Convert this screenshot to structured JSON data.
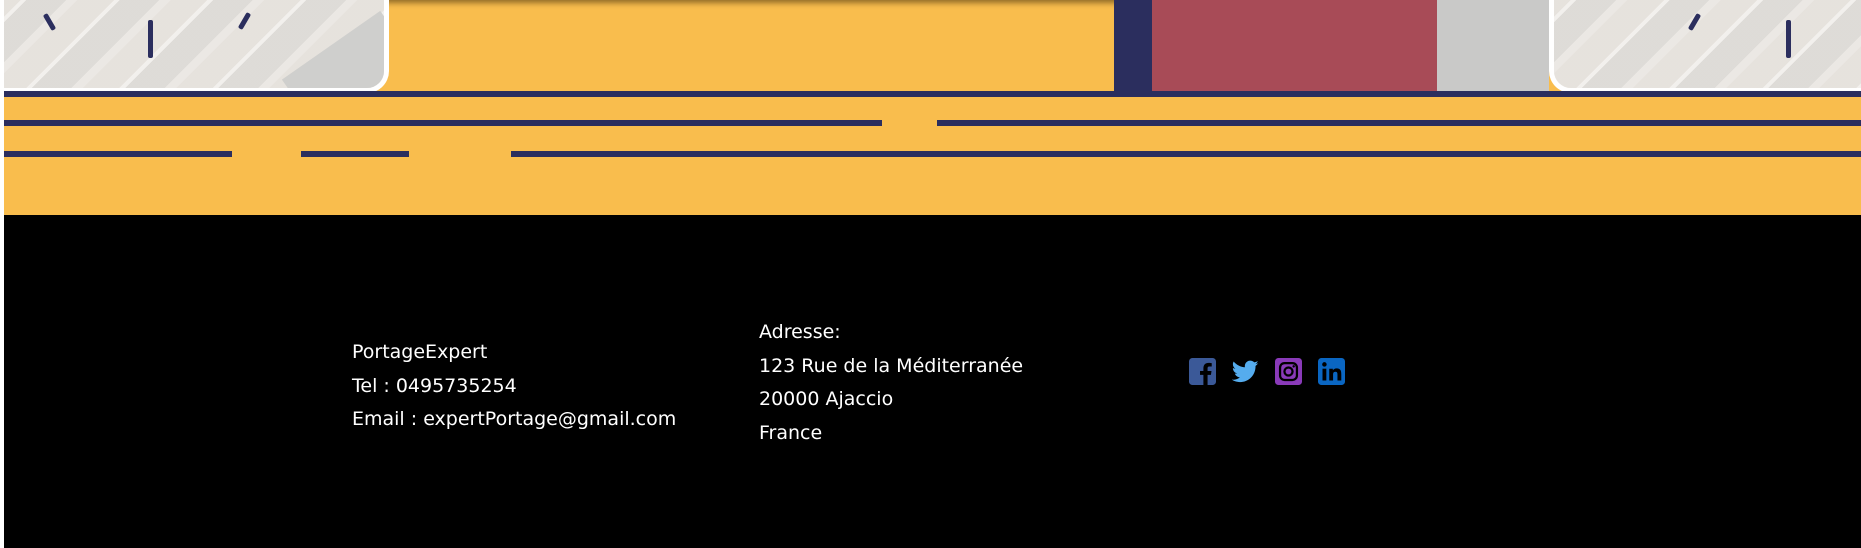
{
  "footer": {
    "contact": {
      "company": "PortageExpert",
      "tel": "Tel : 0495735254",
      "email": "Email : expertPortage@gmail.com"
    },
    "address": {
      "label": "Adresse:",
      "street": "123 Rue de la Méditerranée",
      "city": "20000 Ajaccio",
      "country": "France"
    },
    "social": [
      {
        "icon": "facebook-icon",
        "color": "#3b5998"
      },
      {
        "icon": "twitter-icon",
        "color": "#55acee"
      },
      {
        "icon": "instagram-icon",
        "color": "#8a3ab9"
      },
      {
        "icon": "linkedin-icon",
        "color": "#0a66c2"
      }
    ]
  },
  "colors": {
    "banner_yellow": "#f9bd4d",
    "navy": "#2b2e5e",
    "door_red": "#a84b57",
    "footer_bg": "#000000",
    "footer_text": "#ffffff"
  }
}
